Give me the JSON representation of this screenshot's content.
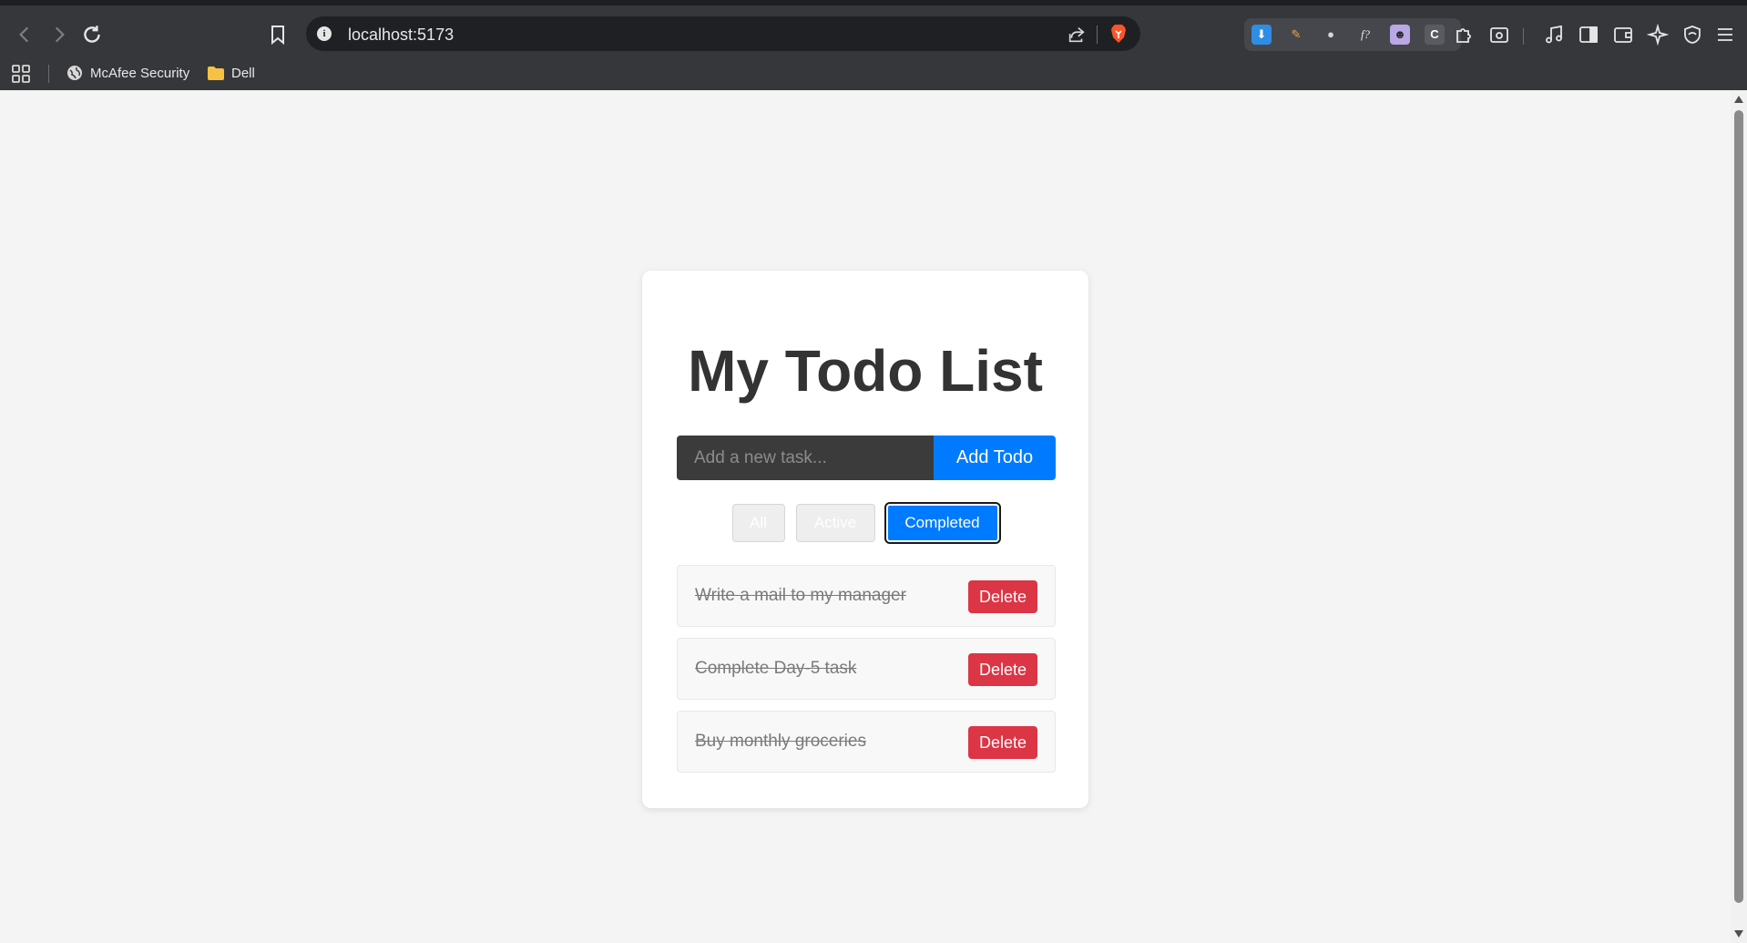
{
  "browser": {
    "url": "localhost:5173",
    "bookmarks": [
      {
        "label": "McAfee Security",
        "icon": "globe-icon"
      },
      {
        "label": "Dell",
        "icon": "folder-icon"
      }
    ],
    "extension_c_label": "C",
    "extension_ft_label": "f?"
  },
  "app": {
    "title": "My Todo List",
    "input_placeholder": "Add a new task...",
    "input_value": "",
    "add_button_label": "Add Todo",
    "filters": [
      {
        "label": "All",
        "selected": false
      },
      {
        "label": "Active",
        "selected": false
      },
      {
        "label": "Completed",
        "selected": true
      }
    ],
    "todos": [
      {
        "text": "Write a mail to my manager",
        "completed": true,
        "delete_label": "Delete"
      },
      {
        "text": "Complete Day-5 task",
        "completed": true,
        "delete_label": "Delete"
      },
      {
        "text": "Buy monthly groceries",
        "completed": true,
        "delete_label": "Delete"
      }
    ]
  },
  "colors": {
    "primary": "#007bff",
    "danger": "#dc3545",
    "title": "#333333",
    "page_bg": "#f4f4f4",
    "chrome_bg": "#36373b"
  }
}
